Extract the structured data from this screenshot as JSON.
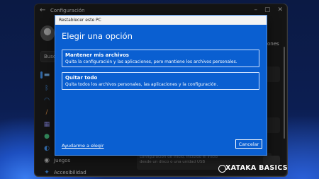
{
  "settings_window": {
    "title": "Configuración",
    "search_partial": "Busc",
    "right_peek_text": "ones",
    "nav_items": [
      {
        "label": "Juegos",
        "icon": "game-controller-icon"
      },
      {
        "label": "Accesibilidad",
        "icon": "accessibility-icon"
      }
    ],
    "bottom_text_1": "configuración de inicio, incluido el inicio",
    "bottom_text_2": "desde un disco o una unidad USB"
  },
  "dialog": {
    "title": "Restablecer este PC",
    "heading": "Elegir una opción",
    "options": [
      {
        "title": "Mantener mis archivos",
        "description": "Quita la configuración y las aplicaciones, pero mantiene los archivos personales."
      },
      {
        "title": "Quitar todo",
        "description": "Quita todos los archivos personales, las aplicaciones y la configuración."
      }
    ],
    "help_link": "Ayudarme a elegir",
    "cancel_label": "Cancelar"
  },
  "watermark": "XATAKA BASICS",
  "colors": {
    "dialog_blue": "#0a5fd1",
    "settings_bg": "#202020",
    "accent": "#4ca0ff"
  }
}
